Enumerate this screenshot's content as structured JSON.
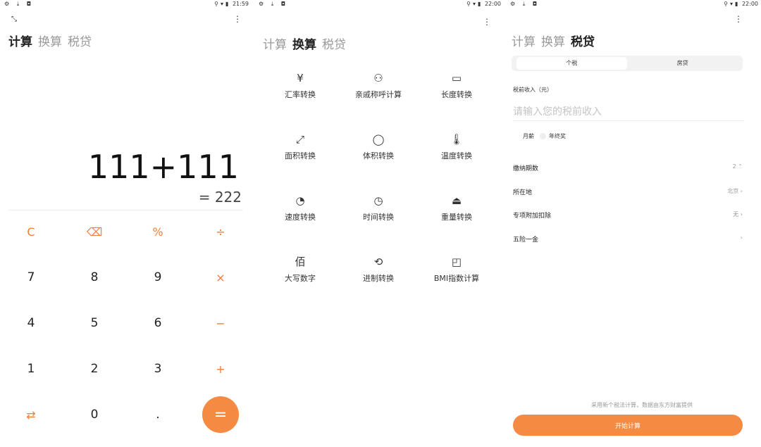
{
  "panels": [
    {
      "status": {
        "left": "⚙ ⤓ ◘",
        "time": "21:59"
      },
      "tabs": [
        "计算",
        "换算",
        "税贷"
      ],
      "active_tab": 0,
      "calculator": {
        "expression": "111+111",
        "result": "= 222",
        "keys": {
          "clear": "C",
          "backspace": "⌫",
          "percent": "%",
          "divide": "÷",
          "seven": "7",
          "eight": "8",
          "nine": "9",
          "multiply": "×",
          "four": "4",
          "five": "5",
          "six": "6",
          "minus": "−",
          "one": "1",
          "two": "2",
          "three": "3",
          "plus": "+",
          "mode": "⇄",
          "zero": "0",
          "dot": ".",
          "equals": "="
        }
      }
    },
    {
      "status": {
        "left": "⚙ ⤓ ◘",
        "time": "22:00"
      },
      "tabs": [
        "计算",
        "换算",
        "税贷"
      ],
      "active_tab": 1,
      "converters": [
        {
          "icon": "¥",
          "label": "汇率转换"
        },
        {
          "icon": "⚇",
          "label": "亲戚称呼计算"
        },
        {
          "icon": "▭",
          "label": "长度转换"
        },
        {
          "icon": "⤢",
          "label": "面积转换"
        },
        {
          "icon": "◯",
          "label": "体积转换"
        },
        {
          "icon": "🌡",
          "label": "温度转换"
        },
        {
          "icon": "◔",
          "label": "速度转换"
        },
        {
          "icon": "◷",
          "label": "时间转换"
        },
        {
          "icon": "⏏",
          "label": "重量转换"
        },
        {
          "icon": "佰",
          "label": "大写数字"
        },
        {
          "icon": "⟲",
          "label": "进制转换"
        },
        {
          "icon": "◰",
          "label": "BMI指数计算"
        }
      ]
    },
    {
      "status": {
        "left": "⚙ ⤓ ◘",
        "time": "22:00"
      },
      "tabs": [
        "计算",
        "换算",
        "税贷"
      ],
      "active_tab": 2,
      "tax": {
        "seg_options": [
          "个税",
          "房贷"
        ],
        "income_label": "税前收入（元）",
        "income_placeholder": "请输入您的税前收入",
        "radio_options": [
          "月薪",
          "年终奖"
        ],
        "rows": [
          {
            "label": "缴纳期数",
            "value": "2 ⌃"
          },
          {
            "label": "所在地",
            "value": "北京 ›"
          },
          {
            "label": "专项附加扣除",
            "value": "无 ›"
          },
          {
            "label": "五险一金",
            "value": "›"
          }
        ],
        "footnote": "采用新个税法计算，数据由东方财富提供",
        "start_button": "开始计算"
      }
    }
  ],
  "accent_color": "#f58a42"
}
